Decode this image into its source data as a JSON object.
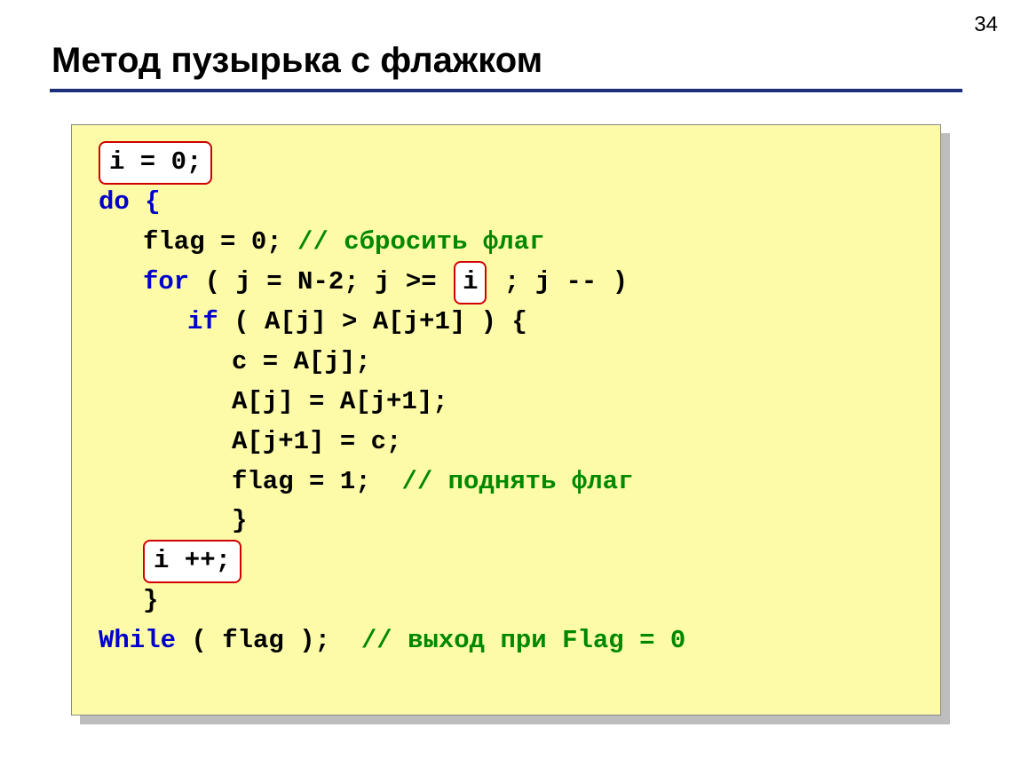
{
  "page_number": "34",
  "title": "Метод пузырька с флажком",
  "code": {
    "l1": "i = 0;",
    "l2": "do {",
    "l3a": "flag = 0;",
    "l3b": " // сбросить флаг",
    "l4a": "for",
    "l4b": " ( j = N-2; j >= ",
    "l4c": "i",
    "l4d": " ; j -- )",
    "l5a": "if",
    "l5b": " ( A[j] > A[j+1] ) {",
    "l6": "с = A[j];",
    "l7": "A[j] = A[j+1];",
    "l8": "A[j+1] = с;",
    "l9a": "flag = 1;  ",
    "l9b": "// поднять флаг",
    "l10": "}",
    "l11": "i ++;",
    "l12": "}",
    "l13a": "While",
    "l13b": " ( flag );  ",
    "l13c": "// выход при Flag = 0"
  }
}
